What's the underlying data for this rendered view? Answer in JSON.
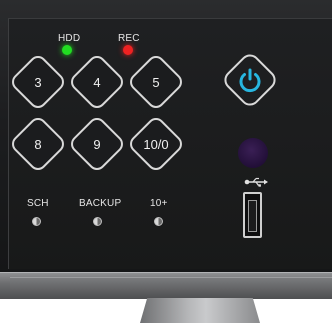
{
  "indicators": {
    "hdd": {
      "label": "HDD",
      "color": "#22dd22"
    },
    "rec": {
      "label": "REC",
      "color": "#ee2222"
    }
  },
  "keypad": {
    "row1": [
      "3",
      "4",
      "5"
    ],
    "row2": [
      "8",
      "9",
      "10/0"
    ]
  },
  "power": {
    "icon": "power-icon",
    "color": "#27b6e0"
  },
  "usb": {
    "icon": "usb-icon"
  },
  "buttons": {
    "sch": "SCH",
    "backup": "BACKUP",
    "plus10": "10+"
  }
}
